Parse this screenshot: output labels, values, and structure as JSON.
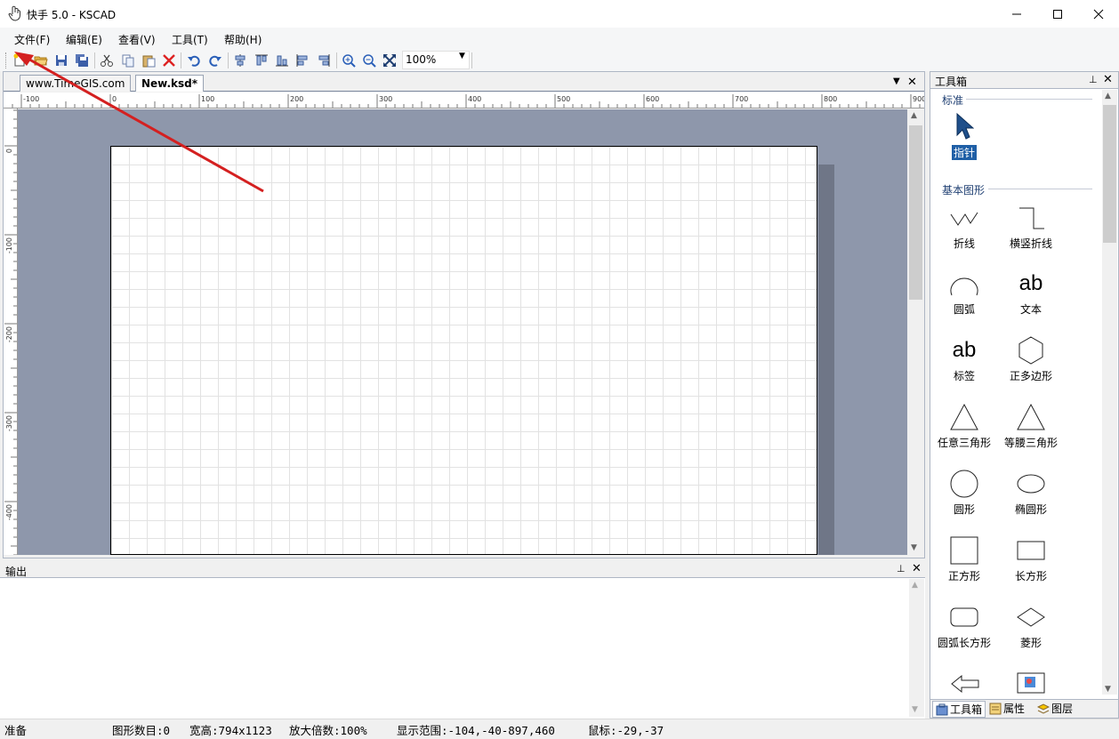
{
  "window": {
    "title": "快手 5.0 - KSCAD"
  },
  "menu": [
    "文件(F)",
    "编辑(E)",
    "查看(V)",
    "工具(T)",
    "帮助(H)"
  ],
  "toolbar": {
    "zoom": "100%"
  },
  "tabs": [
    {
      "label": "www.TimeGIS.com",
      "active": false
    },
    {
      "label": "New.ksd*",
      "active": true
    }
  ],
  "ruler": {
    "h_labels": [
      "-100",
      "0",
      "100",
      "200",
      "300",
      "400",
      "500",
      "600",
      "700",
      "800",
      "900"
    ],
    "v_labels": [
      "0",
      "-100",
      "-200",
      "-300",
      "-400"
    ]
  },
  "output": {
    "title": "输出"
  },
  "toolbox": {
    "title": "工具箱",
    "sections": [
      {
        "label": "标准",
        "tools": [
          {
            "label": "指针",
            "icon": "pointer-icon"
          }
        ]
      },
      {
        "label": "基本图形",
        "tools": [
          {
            "label": "折线",
            "icon": "polyline-icon"
          },
          {
            "label": "横竖折线",
            "icon": "orthogonal-line-icon"
          },
          {
            "label": "圆弧",
            "icon": "arc-icon"
          },
          {
            "label": "文本",
            "icon": "text-icon",
            "glyph": "ab"
          },
          {
            "label": "标签",
            "icon": "label-icon",
            "glyph": "ab"
          },
          {
            "label": "正多边形",
            "icon": "hexagon-icon"
          },
          {
            "label": "任意三角形",
            "icon": "triangle-icon"
          },
          {
            "label": "等腰三角形",
            "icon": "isosceles-triangle-icon"
          },
          {
            "label": "圆形",
            "icon": "circle-icon"
          },
          {
            "label": "椭圆形",
            "icon": "ellipse-icon"
          },
          {
            "label": "正方形",
            "icon": "square-icon"
          },
          {
            "label": "长方形",
            "icon": "rectangle-icon"
          },
          {
            "label": "圆弧长方形",
            "icon": "rounded-rectangle-icon"
          },
          {
            "label": "菱形",
            "icon": "diamond-icon"
          }
        ]
      }
    ],
    "bottom_tabs": [
      "工具箱",
      "属性",
      "图层"
    ]
  },
  "status": {
    "ready": "准备",
    "shape_count": "图形数目:0",
    "size": "宽高:794x1123",
    "zoom": "放大倍数:100%",
    "range": "显示范围:-104,-40-897,460",
    "mouse": "鼠标:-29,-37"
  },
  "colors": {
    "canvas_bg": "#8e97ab",
    "annotation_arrow": "#d42020",
    "section_label": "#1f3f72"
  }
}
